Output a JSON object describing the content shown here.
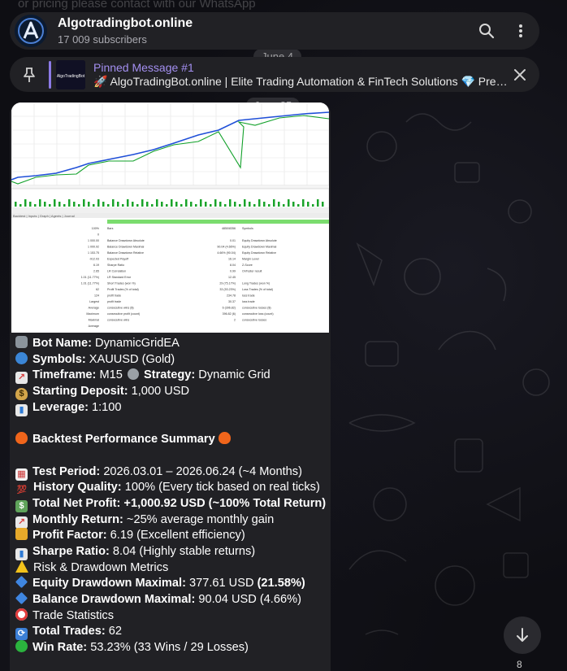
{
  "top_fade_text": "or pricing please contact with our WhatsApp",
  "header": {
    "title": "Algotradingbot.online",
    "subscribers": "17 009 subscribers"
  },
  "pinned": {
    "title": "Pinned Message #1",
    "text": "🚀 AlgoTradingBot.online | Elite Trading Automation & FinTech Solutions 💎 Premium …",
    "thumb_label": "AlgoTradingBot"
  },
  "dates": {
    "d1": "June 4",
    "d2": "June 25"
  },
  "report": {
    "rows_left": [
      "100%",
      "0",
      "1 000.00",
      "1 000.92",
      "1 153.75",
      "-912.03",
      "6.19",
      "2.65",
      "1.01 (11.77%)",
      "1.01 (11.77%)",
      "62",
      "124",
      "Largest",
      "Average",
      "Maximum",
      "Maximal",
      "Average"
    ],
    "rows_mid": [
      "Bars",
      "",
      "Balance Drawdown Absolute",
      "Balance Drawdown Maximal",
      "Balance Drawdown Relative",
      "Expected Payoff",
      "Sharpe Ratio",
      "LR Correlation",
      "LR Standard Error",
      "Short Trades (won %)",
      "Profit Trades (% of total)",
      "profit trade",
      "profit trade",
      "consecutive wins ($)",
      "consecutive profit (count)",
      "consecutive wins"
    ],
    "rows_vals": [
      "4850/8356",
      "",
      "0.01",
      "90.04 (4.66%)",
      "4.66% (90.04)",
      "16.14",
      "8.04",
      "0.99",
      "12.45",
      "29 (75.17%)",
      "33 (53.23%)",
      "234.78",
      "30.37",
      "6 (396.82)",
      "396.82 (6)",
      "2"
    ],
    "rows_right": [
      "Symbols",
      "",
      "Equity Drawdown Absolute",
      "Equity Drawdown Maximal",
      "Equity Drawdown Relative",
      "Margin Level",
      "Z-Score",
      "OnTester result",
      "",
      "Long Trades (won %)",
      "Loss Trades (% of total)",
      "loss trade",
      "loss trade",
      "consecutive losses ($)",
      "consecutive loss (count)",
      "consecutive losses"
    ],
    "tabs": "Backtest | Inputs | Graph | Agents | Journal"
  },
  "message": {
    "bot_label": "Bot Name:",
    "bot_value": " DynamicGridEA",
    "symbols_label": "Symbols:",
    "symbols_value": " XAUUSD (Gold)",
    "timeframe_label": "Timeframe:",
    "timeframe_value": " M15 ",
    "strategy_label": "Strategy:",
    "strategy_value": " Dynamic Grid",
    "deposit_label": "Starting Deposit:",
    "deposit_value": " 1,000 USD",
    "leverage_label": "Leverage:",
    "leverage_value": " 1:100",
    "summary_heading": "Backtest Performance Summary",
    "period_label": "Test Period:",
    "period_value": " 2026.03.01 – 2026.06.24 (~4 Months)",
    "quality_label": "History Quality:",
    "quality_value": " 100% (Every tick based on real ticks)",
    "profit_label": "Total Net Profit:",
    "profit_value": " +1,000.92 USD (~100% Total Return)",
    "monthly_label": "Monthly Return:",
    "monthly_value": " ~25% average monthly gain",
    "pf_label": "Profit Factor:",
    "pf_value": " 6.19 (Excellent efficiency)",
    "sharpe_label": "Sharpe Ratio:",
    "sharpe_value": " 8.04 (Highly stable returns)",
    "risk_heading": "Risk & Drawdown Metrics",
    "eqdd_label": "Equity Drawdown Maximal:",
    "eqdd_value": " 377.61 USD ",
    "eqdd_pct": "(21.58%)",
    "baldd_label": "Balance Drawdown Maximal:",
    "baldd_value": " 90.04 USD (4.66%)",
    "trade_heading": "Trade Statistics",
    "trades_label": "Total Trades:",
    "trades_value": " 62",
    "win_label": "Win Rate:",
    "win_value": " 53.23% (33 Wins / 29 Losses)"
  },
  "corner_count": "8"
}
